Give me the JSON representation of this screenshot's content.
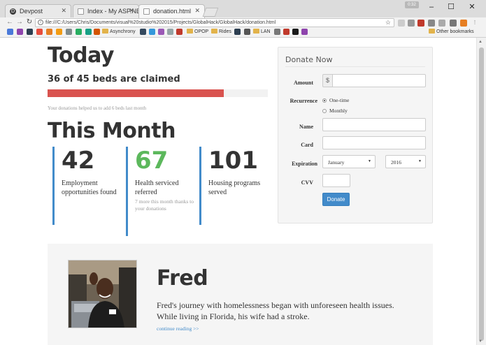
{
  "browser": {
    "tabs": [
      {
        "label": "Devpost",
        "icon": "devpost-icon",
        "color": "#3d3d3d"
      },
      {
        "label": "Index - My ASP.NE",
        "icon": "page-icon",
        "color": "#6a8bd0"
      },
      {
        "label": "donation.html",
        "icon": "page-icon",
        "color": "#6a8bd0"
      }
    ],
    "profile_badge": "0:32",
    "url": "file:///C:/Users/Chris/Documents/visual%20studio%202015/Projects/GlobalHack/GlobalHack/donation.html",
    "bookmarks": {
      "folders": [
        "Asynchrony",
        "OPOP",
        "Rides",
        "LAN"
      ],
      "other": "Other bookmarks"
    }
  },
  "today": {
    "title": "Today",
    "beds_text": "36 of 45 beds are claimed",
    "beds_claimed": 36,
    "beds_total": 45,
    "progress_color": "#d9534f",
    "helped_text": "Your donations helped us to add 6 beds last month"
  },
  "month": {
    "title": "This Month",
    "stats": [
      {
        "value": "42",
        "label": "Employment opportunities found",
        "sub": ""
      },
      {
        "value": "67",
        "label": "Health serviced referred",
        "sub": "7 more this month thanks to your donations"
      },
      {
        "value": "101",
        "label": "Housing programs served",
        "sub": ""
      }
    ],
    "accent_color": "#428bca",
    "highlight_color": "#5cb85c"
  },
  "donate": {
    "title": "Donate Now",
    "amount_label": "Amount",
    "currency_symbol": "$",
    "recurrence_label": "Recurrence",
    "recurrence_options": [
      "One-time",
      "Monthly"
    ],
    "recurrence_selected": "One-time",
    "name_label": "Name",
    "card_label": "Card",
    "expiration_label": "Expiration",
    "expiration_month": "January",
    "expiration_year": "2016",
    "cvv_label": "CVV",
    "button_label": "Donate",
    "button_color": "#428bca"
  },
  "story": {
    "name": "Fred",
    "text": "Fred's journey with homelessness began with unforeseen health issues. While living in Florida, his wife had a stroke.",
    "link": "continue reading >>"
  }
}
